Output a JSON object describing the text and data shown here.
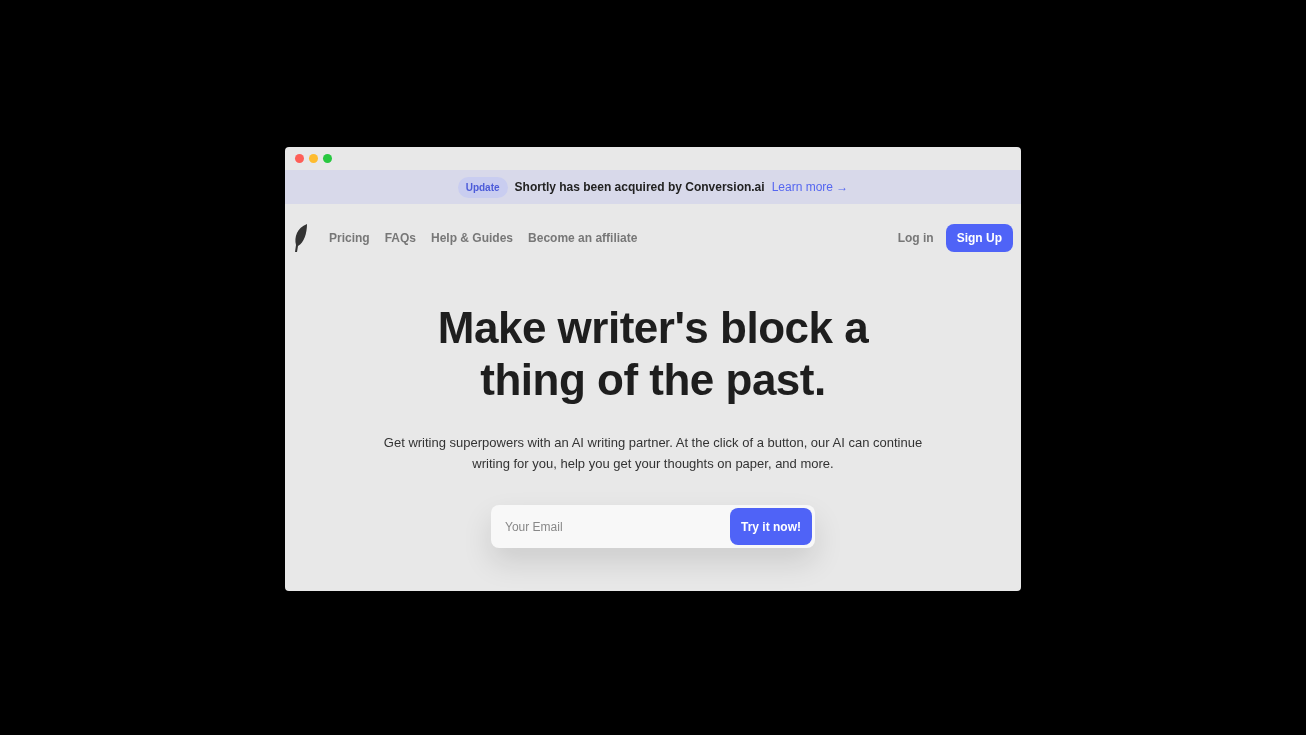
{
  "banner": {
    "badge": "Update",
    "message": "Shortly has been acquired by Conversion.ai",
    "link": "Learn more →"
  },
  "nav": {
    "links": [
      "Pricing",
      "FAQs",
      "Help & Guides",
      "Become an affiliate"
    ],
    "login": "Log in",
    "signup": "Sign Up"
  },
  "hero": {
    "title_lines": [
      "Make writer's block a",
      "thing of the past."
    ],
    "subtitle": "Get writing superpowers with an AI writing partner. At the click of a button, our AI can continue writing for you, help you get your thoughts on paper, and more."
  },
  "signup_form": {
    "placeholder": "Your Email",
    "button": "Try it now!"
  }
}
